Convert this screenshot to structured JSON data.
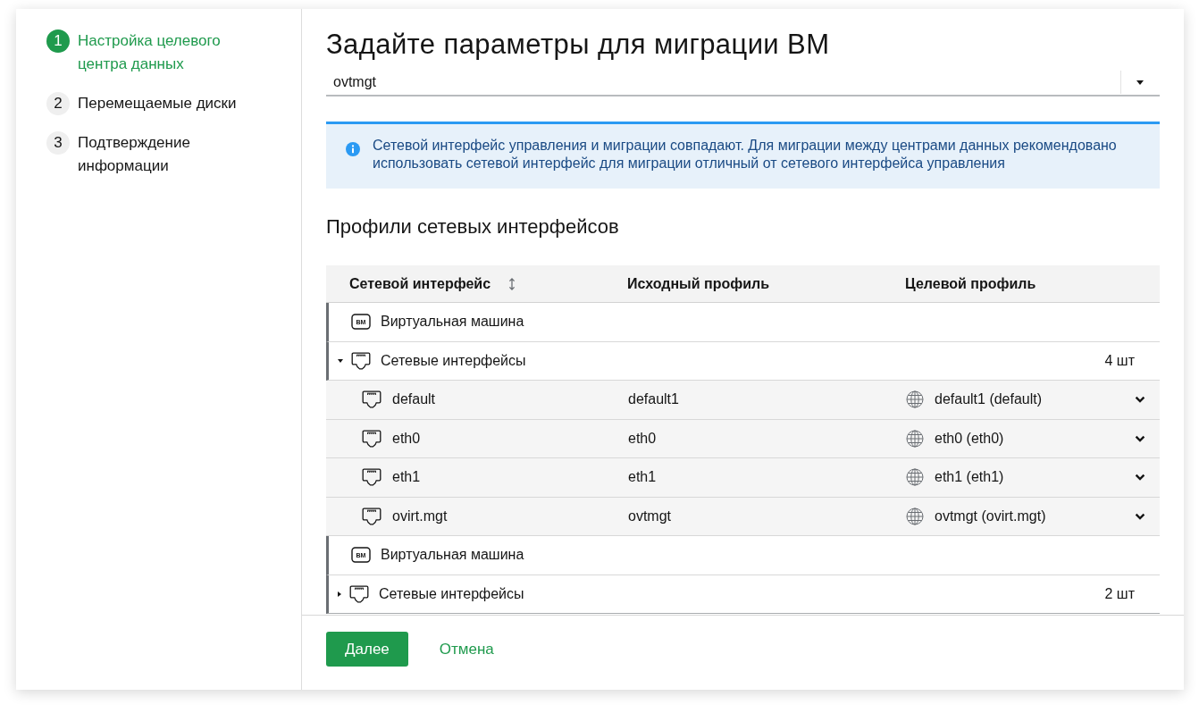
{
  "wizard_steps": [
    {
      "number": "1",
      "label": "Настройка целевого центра данных",
      "selected": true
    },
    {
      "number": "2",
      "label": "Перемещаемые диски",
      "selected": false
    },
    {
      "number": "3",
      "label": "Подтверждение информации",
      "selected": false
    }
  ],
  "title": "Задайте параметры для миграции ВМ",
  "network_select": {
    "value": "ovtmgt"
  },
  "alert": {
    "kind": "info",
    "text": "Сетевой интерфейс управления и миграции совпадают. Для миграции между центрами данных рекомендовано использовать сетевой интерфейс для миграции отличный от сетевого интерфейса управления"
  },
  "section_title": "Профили сетевых интерфейсов",
  "table": {
    "columns": [
      {
        "label": "Сетевой интерфейс",
        "sortable": true
      },
      {
        "label": "Исходный профиль",
        "sortable": false
      },
      {
        "label": "Целевой профиль",
        "sortable": false
      }
    ],
    "rows": [
      {
        "icon_text": "ВМ",
        "vm_label": "Виртуальная машина",
        "interfaces_label": "Сетевые интерфейсы",
        "count": "4 шт",
        "expanded": true,
        "children": [
          {
            "name": "default",
            "source_profile": "default1",
            "target_profile": "default1 (default)"
          },
          {
            "name": "eth0",
            "source_profile": "eth0",
            "target_profile": "eth0 (eth0)"
          },
          {
            "name": "eth1",
            "source_profile": "eth1",
            "target_profile": "eth1 (eth1)"
          },
          {
            "name": "ovirt.mgt",
            "source_profile": "ovtmgt",
            "target_profile": "ovtmgt (ovirt.mgt)"
          }
        ]
      },
      {
        "icon_text": "ВМ",
        "vm_label": "Виртуальная машина",
        "interfaces_label": "Сетевые интерфейсы",
        "count": "2 шт",
        "expanded": false
      }
    ]
  },
  "buttons": [
    {
      "label": "Далее",
      "kind": "primary"
    },
    {
      "label": "Отмена",
      "kind": "link"
    }
  ]
}
